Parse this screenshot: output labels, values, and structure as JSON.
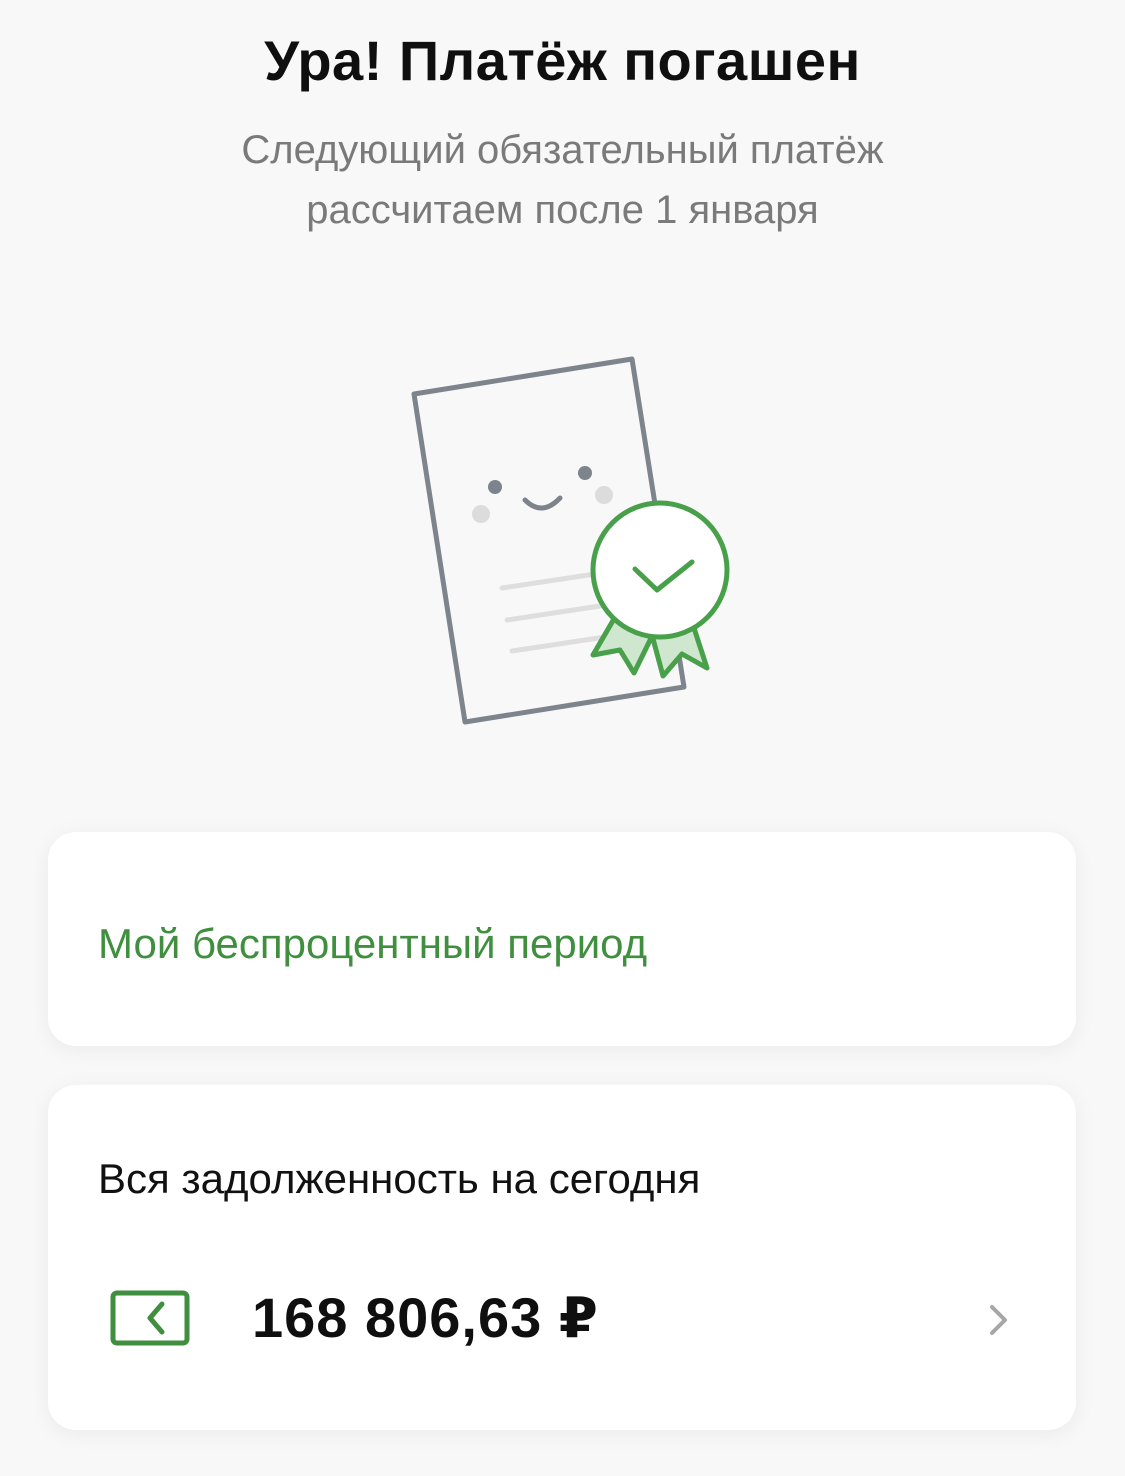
{
  "header": {
    "title": "Ура! Платёж погашен",
    "subtitle_line1": "Следующий обязательный платёж",
    "subtitle_line2": "рассчитаем после 1 января"
  },
  "illustration": {
    "icon": "document-with-award-icon"
  },
  "period_card": {
    "link_label": "Мой беспроцентный период"
  },
  "debt_card": {
    "label": "Вся задолженность на сегодня",
    "amount": "168 806,63 ₽",
    "icon": "card-back-icon",
    "chevron": "chevron-right-icon"
  },
  "colors": {
    "accent_green": "#3f8f3f",
    "background": "#f8f8f8",
    "card": "#ffffff",
    "subtitle_gray": "#7a7a7a"
  }
}
